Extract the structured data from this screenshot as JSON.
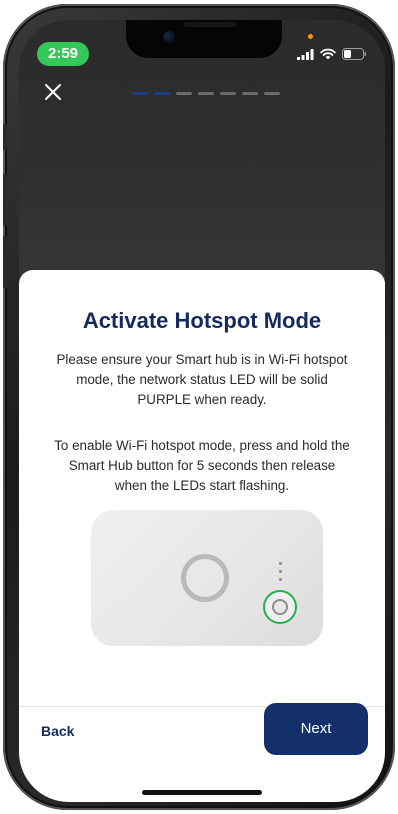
{
  "status_bar": {
    "time": "2:59",
    "signal_icon": "cellular-signal-icon",
    "wifi_icon": "wifi-icon",
    "battery_icon": "battery-icon"
  },
  "header": {
    "close_icon": "close-icon",
    "progress": {
      "total_steps": 7,
      "active_steps": 2
    }
  },
  "content": {
    "title": "Activate Hotspot Mode",
    "paragraph_1": "Please ensure your Smart hub is in Wi-Fi hotspot mode, the network status LED will be solid PURPLE when ready.",
    "paragraph_2": "To enable Wi-Fi hotspot mode, press and hold the Smart Hub button for 5 seconds then release when the LEDs start flashing."
  },
  "footer": {
    "back_label": "Back",
    "next_label": "Next"
  },
  "colors": {
    "brand_navy": "#13306b",
    "title_navy": "#152a5e",
    "status_green": "#34c759",
    "button_highlight_green": "#22b24c"
  }
}
